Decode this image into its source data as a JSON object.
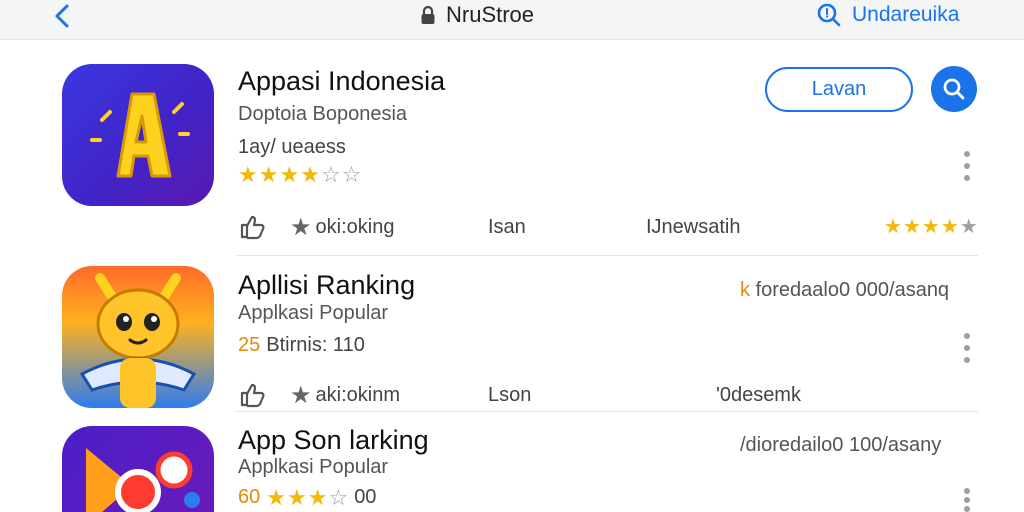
{
  "colors": {
    "accent": "#1a73e8",
    "star": "#f2b80a",
    "rank_orange": "#e08a0e"
  },
  "topbar": {
    "back_icon": "chevron-left-icon",
    "lock_icon": "lock-icon",
    "title": "NruStroe",
    "search_icon": "search-icon",
    "search_label": "Undareuika"
  },
  "featured": {
    "name": "Appasi Indonesia",
    "subtitle": "Doptoia Boponesia",
    "meta": "1ay/ ueaess",
    "rating": 3.5,
    "button_label": "Lavan",
    "actions": {
      "like_icon": "thumbs-up-icon",
      "star_icon": "star-icon",
      "ranking": "oki:oking",
      "col2": "Isan",
      "col3": "IJnewsatih",
      "rating": 3.5
    }
  },
  "apps": [
    {
      "name": "Apllisi Ranking",
      "subtitle": "Applkasi Popular",
      "meta_num": "25",
      "meta_text": "Btirnis: 110",
      "right_note_prefix": "k",
      "right_note": "foredaalo0 000/asanq",
      "actions": {
        "ranking": "aki:okinm",
        "col2": "Lson",
        "col3": "'0desemk"
      }
    },
    {
      "name": "App Son larking",
      "subtitle": "Applkasi Popular",
      "meta_num": "60",
      "meta_text": "00",
      "rating": 3.5,
      "right_note": "/dioredailo0 100/asany"
    }
  ]
}
